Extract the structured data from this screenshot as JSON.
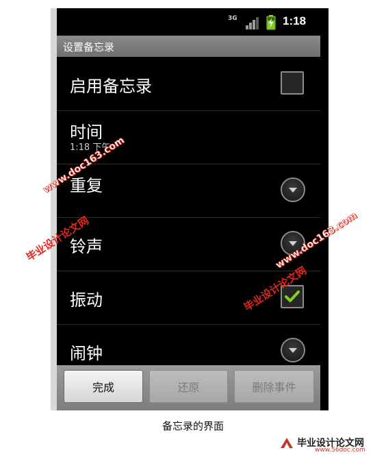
{
  "status_bar": {
    "network": "3G",
    "time": "1:18"
  },
  "title_bar": {
    "title": "设置备忘录"
  },
  "settings": {
    "items": [
      {
        "label": "启用备忘录",
        "control": "checkbox",
        "checked": false
      },
      {
        "label": "时间",
        "sublabel": "1:18 下午",
        "control": "none"
      },
      {
        "label": "重复",
        "control": "dropdown"
      },
      {
        "label": "铃声",
        "control": "dropdown"
      },
      {
        "label": "振动",
        "control": "checkbox",
        "checked": true
      },
      {
        "label": "闹钟",
        "control": "dropdown"
      }
    ]
  },
  "buttons": {
    "done": "完成",
    "revert": "还原",
    "delete_event": "删除事件"
  },
  "caption": "备忘录的界面",
  "watermarks": {
    "cn": "毕业设计论文网",
    "url": "www.doc163.com",
    "footer_cn": "毕业设计论文网",
    "footer_url": "www.56doc.com"
  },
  "colors": {
    "check_green": "#7ed321",
    "watermark_red": "#e0281e"
  }
}
